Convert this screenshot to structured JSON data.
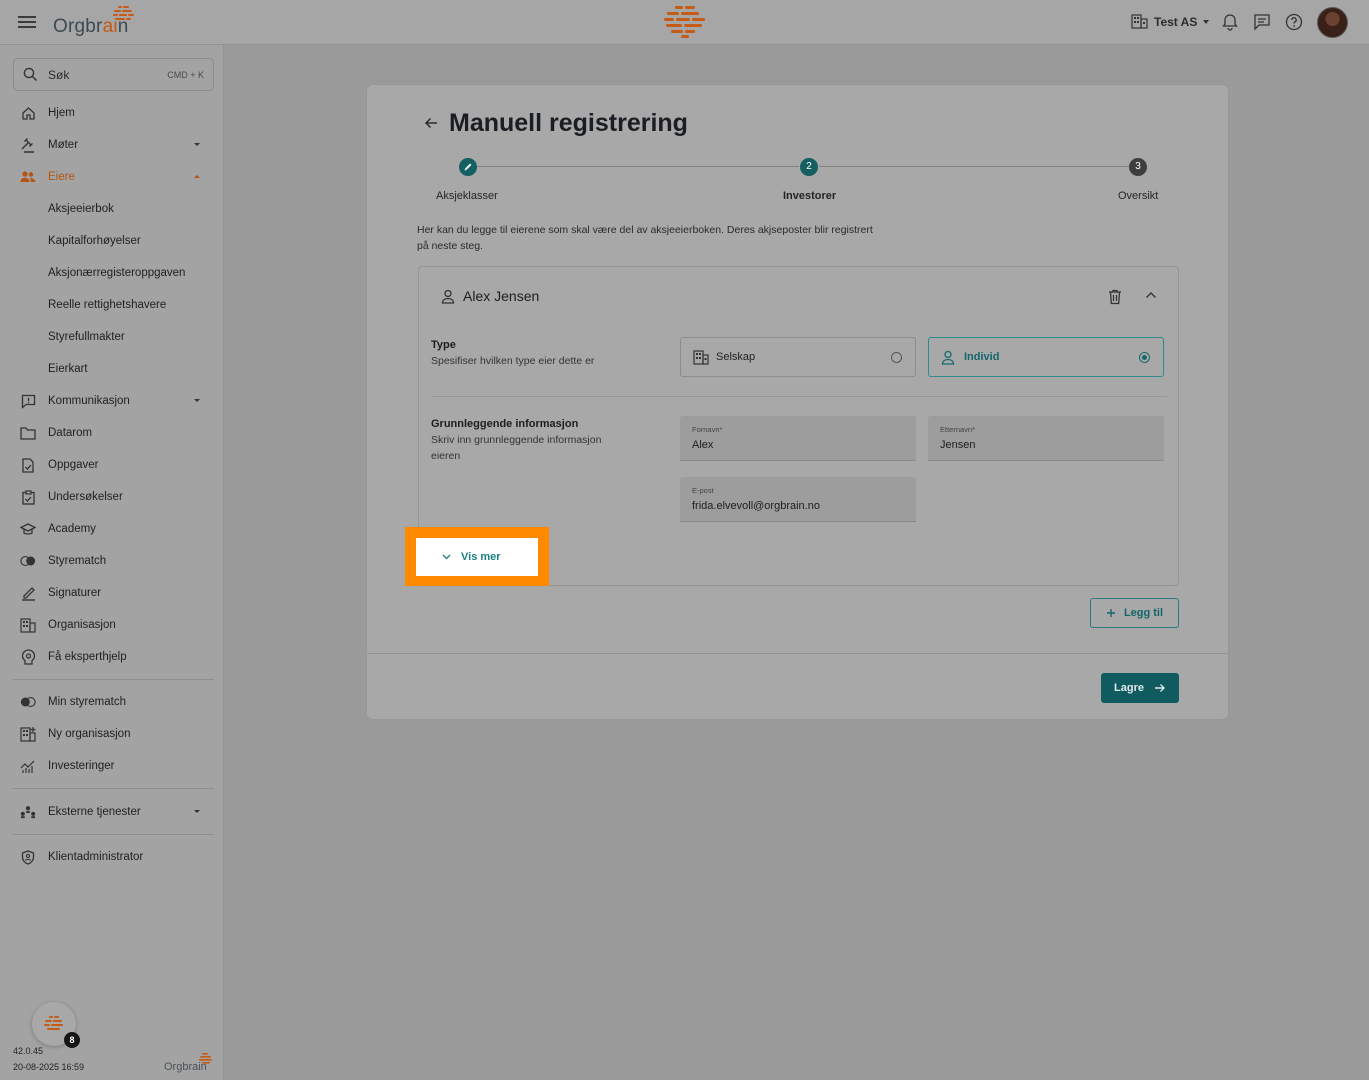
{
  "header": {
    "brand_prefix": "Orgbr",
    "brand_ai": "ai",
    "brand_suffix": "n",
    "org_name": "Test AS",
    "icons": [
      "menu-icon",
      "bell-icon",
      "chat-icon",
      "help-icon"
    ]
  },
  "search": {
    "placeholder": "Søk",
    "shortcut": "CMD + K"
  },
  "sidebar": {
    "items": [
      {
        "label": "Hjem",
        "icon": "home-icon"
      },
      {
        "label": "Møter",
        "icon": "gavel-icon"
      },
      {
        "label": "Eiere",
        "icon": "owners-icon"
      },
      {
        "label": "Aksjeeierbok"
      },
      {
        "label": "Kapitalforhøyelser"
      },
      {
        "label": "Aksjonærregisteroppgaven"
      },
      {
        "label": "Reelle rettighetshavere"
      },
      {
        "label": "Styrefullmakter"
      },
      {
        "label": "Eierkart"
      },
      {
        "label": "Kommunikasjon",
        "icon": "announcement-icon"
      },
      {
        "label": "Datarom",
        "icon": "folder-icon"
      },
      {
        "label": "Oppgaver",
        "icon": "task-icon"
      },
      {
        "label": "Undersøkelser",
        "icon": "survey-icon"
      },
      {
        "label": "Academy",
        "icon": "academy-icon"
      },
      {
        "label": "Styrematch",
        "icon": "match-icon"
      },
      {
        "label": "Signaturer",
        "icon": "signature-icon"
      },
      {
        "label": "Organisasjon",
        "icon": "building-icon"
      },
      {
        "label": "Få eksperthjelp",
        "icon": "expert-icon"
      },
      {
        "label": "Min styrematch",
        "icon": "match-icon"
      },
      {
        "label": "Ny organisasjon",
        "icon": "new-org-icon"
      },
      {
        "label": "Investeringer",
        "icon": "chart-icon"
      },
      {
        "label": "Eksterne tjenester",
        "icon": "services-icon"
      },
      {
        "label": "Klientadministrator",
        "icon": "shield-icon"
      }
    ],
    "version": "42.0.45",
    "timestamp": "20-08-2025 16:59",
    "help_badge": "8",
    "footer_brand": "Orgbrain"
  },
  "main": {
    "title": "Manuell registrering",
    "steps": [
      {
        "num": "",
        "label": "Aksjeklasser"
      },
      {
        "num": "2",
        "label": "Investorer"
      },
      {
        "num": "3",
        "label": "Oversikt"
      }
    ],
    "intro": "Her kan du legge til eierene som skal være del av aksjeeierboken. Deres akjseposter blir registrert på neste steg.",
    "owner": {
      "name": "Alex Jensen",
      "type_title": "Type",
      "type_sub": "Spesifiser hvilken type eier dette er",
      "option_company": "Selskap",
      "option_individual": "Individ",
      "basic_title": "Grunnleggende informasjon",
      "basic_sub": "Skriv inn grunnleggende informasjon eieren",
      "first_name_label": "Fornavn*",
      "first_name": "Alex",
      "last_name_label": "Etternavn*",
      "last_name": "Jensen",
      "email_label": "E-post",
      "email": "frida.elvevoll@orgbrain.no",
      "show_more": "Vis mer"
    },
    "add_label": "Legg til",
    "save_label": "Lagre"
  },
  "colors": {
    "accent": "#166a6e",
    "brand": "#c25a18",
    "highlight": "#ff8a00"
  }
}
